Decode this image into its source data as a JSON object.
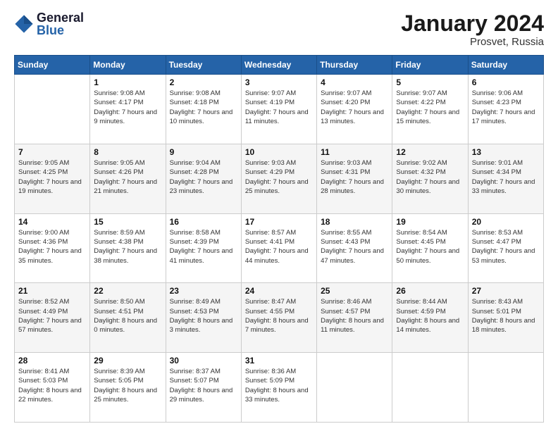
{
  "header": {
    "logo_general": "General",
    "logo_blue": "Blue",
    "month_title": "January 2024",
    "location": "Prosvet, Russia"
  },
  "days_of_week": [
    "Sunday",
    "Monday",
    "Tuesday",
    "Wednesday",
    "Thursday",
    "Friday",
    "Saturday"
  ],
  "weeks": [
    [
      {
        "day": "",
        "sunrise": "",
        "sunset": "",
        "daylight": ""
      },
      {
        "day": "1",
        "sunrise": "Sunrise: 9:08 AM",
        "sunset": "Sunset: 4:17 PM",
        "daylight": "Daylight: 7 hours and 9 minutes."
      },
      {
        "day": "2",
        "sunrise": "Sunrise: 9:08 AM",
        "sunset": "Sunset: 4:18 PM",
        "daylight": "Daylight: 7 hours and 10 minutes."
      },
      {
        "day": "3",
        "sunrise": "Sunrise: 9:07 AM",
        "sunset": "Sunset: 4:19 PM",
        "daylight": "Daylight: 7 hours and 11 minutes."
      },
      {
        "day": "4",
        "sunrise": "Sunrise: 9:07 AM",
        "sunset": "Sunset: 4:20 PM",
        "daylight": "Daylight: 7 hours and 13 minutes."
      },
      {
        "day": "5",
        "sunrise": "Sunrise: 9:07 AM",
        "sunset": "Sunset: 4:22 PM",
        "daylight": "Daylight: 7 hours and 15 minutes."
      },
      {
        "day": "6",
        "sunrise": "Sunrise: 9:06 AM",
        "sunset": "Sunset: 4:23 PM",
        "daylight": "Daylight: 7 hours and 17 minutes."
      }
    ],
    [
      {
        "day": "7",
        "sunrise": "Sunrise: 9:05 AM",
        "sunset": "Sunset: 4:25 PM",
        "daylight": "Daylight: 7 hours and 19 minutes."
      },
      {
        "day": "8",
        "sunrise": "Sunrise: 9:05 AM",
        "sunset": "Sunset: 4:26 PM",
        "daylight": "Daylight: 7 hours and 21 minutes."
      },
      {
        "day": "9",
        "sunrise": "Sunrise: 9:04 AM",
        "sunset": "Sunset: 4:28 PM",
        "daylight": "Daylight: 7 hours and 23 minutes."
      },
      {
        "day": "10",
        "sunrise": "Sunrise: 9:03 AM",
        "sunset": "Sunset: 4:29 PM",
        "daylight": "Daylight: 7 hours and 25 minutes."
      },
      {
        "day": "11",
        "sunrise": "Sunrise: 9:03 AM",
        "sunset": "Sunset: 4:31 PM",
        "daylight": "Daylight: 7 hours and 28 minutes."
      },
      {
        "day": "12",
        "sunrise": "Sunrise: 9:02 AM",
        "sunset": "Sunset: 4:32 PM",
        "daylight": "Daylight: 7 hours and 30 minutes."
      },
      {
        "day": "13",
        "sunrise": "Sunrise: 9:01 AM",
        "sunset": "Sunset: 4:34 PM",
        "daylight": "Daylight: 7 hours and 33 minutes."
      }
    ],
    [
      {
        "day": "14",
        "sunrise": "Sunrise: 9:00 AM",
        "sunset": "Sunset: 4:36 PM",
        "daylight": "Daylight: 7 hours and 35 minutes."
      },
      {
        "day": "15",
        "sunrise": "Sunrise: 8:59 AM",
        "sunset": "Sunset: 4:38 PM",
        "daylight": "Daylight: 7 hours and 38 minutes."
      },
      {
        "day": "16",
        "sunrise": "Sunrise: 8:58 AM",
        "sunset": "Sunset: 4:39 PM",
        "daylight": "Daylight: 7 hours and 41 minutes."
      },
      {
        "day": "17",
        "sunrise": "Sunrise: 8:57 AM",
        "sunset": "Sunset: 4:41 PM",
        "daylight": "Daylight: 7 hours and 44 minutes."
      },
      {
        "day": "18",
        "sunrise": "Sunrise: 8:55 AM",
        "sunset": "Sunset: 4:43 PM",
        "daylight": "Daylight: 7 hours and 47 minutes."
      },
      {
        "day": "19",
        "sunrise": "Sunrise: 8:54 AM",
        "sunset": "Sunset: 4:45 PM",
        "daylight": "Daylight: 7 hours and 50 minutes."
      },
      {
        "day": "20",
        "sunrise": "Sunrise: 8:53 AM",
        "sunset": "Sunset: 4:47 PM",
        "daylight": "Daylight: 7 hours and 53 minutes."
      }
    ],
    [
      {
        "day": "21",
        "sunrise": "Sunrise: 8:52 AM",
        "sunset": "Sunset: 4:49 PM",
        "daylight": "Daylight: 7 hours and 57 minutes."
      },
      {
        "day": "22",
        "sunrise": "Sunrise: 8:50 AM",
        "sunset": "Sunset: 4:51 PM",
        "daylight": "Daylight: 8 hours and 0 minutes."
      },
      {
        "day": "23",
        "sunrise": "Sunrise: 8:49 AM",
        "sunset": "Sunset: 4:53 PM",
        "daylight": "Daylight: 8 hours and 3 minutes."
      },
      {
        "day": "24",
        "sunrise": "Sunrise: 8:47 AM",
        "sunset": "Sunset: 4:55 PM",
        "daylight": "Daylight: 8 hours and 7 minutes."
      },
      {
        "day": "25",
        "sunrise": "Sunrise: 8:46 AM",
        "sunset": "Sunset: 4:57 PM",
        "daylight": "Daylight: 8 hours and 11 minutes."
      },
      {
        "day": "26",
        "sunrise": "Sunrise: 8:44 AM",
        "sunset": "Sunset: 4:59 PM",
        "daylight": "Daylight: 8 hours and 14 minutes."
      },
      {
        "day": "27",
        "sunrise": "Sunrise: 8:43 AM",
        "sunset": "Sunset: 5:01 PM",
        "daylight": "Daylight: 8 hours and 18 minutes."
      }
    ],
    [
      {
        "day": "28",
        "sunrise": "Sunrise: 8:41 AM",
        "sunset": "Sunset: 5:03 PM",
        "daylight": "Daylight: 8 hours and 22 minutes."
      },
      {
        "day": "29",
        "sunrise": "Sunrise: 8:39 AM",
        "sunset": "Sunset: 5:05 PM",
        "daylight": "Daylight: 8 hours and 25 minutes."
      },
      {
        "day": "30",
        "sunrise": "Sunrise: 8:37 AM",
        "sunset": "Sunset: 5:07 PM",
        "daylight": "Daylight: 8 hours and 29 minutes."
      },
      {
        "day": "31",
        "sunrise": "Sunrise: 8:36 AM",
        "sunset": "Sunset: 5:09 PM",
        "daylight": "Daylight: 8 hours and 33 minutes."
      },
      {
        "day": "",
        "sunrise": "",
        "sunset": "",
        "daylight": ""
      },
      {
        "day": "",
        "sunrise": "",
        "sunset": "",
        "daylight": ""
      },
      {
        "day": "",
        "sunrise": "",
        "sunset": "",
        "daylight": ""
      }
    ]
  ]
}
